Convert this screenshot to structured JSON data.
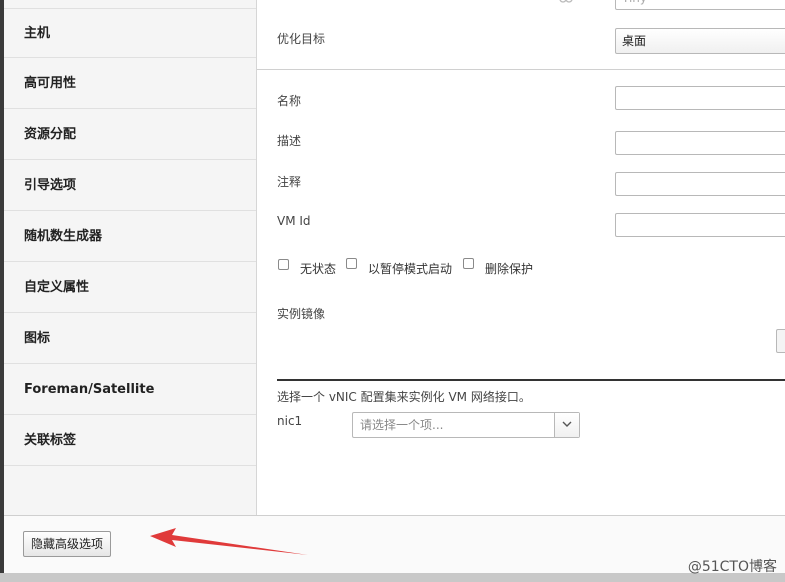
{
  "sidebar": {
    "items": [
      {
        "label": "主机"
      },
      {
        "label": "高可用性"
      },
      {
        "label": "资源分配"
      },
      {
        "label": "引导选项"
      },
      {
        "label": "随机数生成器"
      },
      {
        "label": "自定义属性"
      },
      {
        "label": "图标"
      },
      {
        "label": "Foreman/Satellite"
      },
      {
        "label": "关联标签"
      }
    ]
  },
  "form": {
    "instance_type_value": "Tiny",
    "optimize_label": "优化目标",
    "optimize_value": "桌面",
    "name_label": "名称",
    "description_label": "描述",
    "comment_label": "注释",
    "vm_id_label": "VM Id",
    "checkboxes": [
      {
        "label": "无状态",
        "checked": false
      },
      {
        "label": "以暂停模式启动",
        "checked": false
      },
      {
        "label": "删除保护",
        "checked": false
      }
    ],
    "instance_image_label": "实例镜像"
  },
  "vnic": {
    "description": "选择一个 vNIC 配置集来实例化 VM 网络接口。",
    "nic_label": "nic1",
    "nic_placeholder": "请选择一个项..."
  },
  "footer": {
    "hide_advanced_label": "隐藏高级选项"
  },
  "watermark": "@51CTO博客",
  "colors": {
    "annotation_arrow": "#e03a3a",
    "sidebar_bg": "#f5f5f5"
  }
}
